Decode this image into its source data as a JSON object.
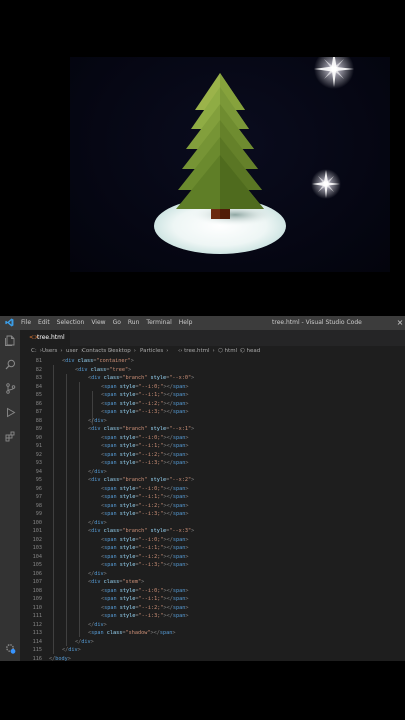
{
  "menu": [
    "File",
    "Edit",
    "Selection",
    "View",
    "Go",
    "Run",
    "Terminal",
    "Help"
  ],
  "window_title": "tree.html - Visual Studio Code",
  "tab": {
    "label": "tree.html",
    "icon": "html-file-icon"
  },
  "breadcrumb": [
    {
      "label": "C:"
    },
    {
      "label": "Users"
    },
    {
      "label": "user"
    },
    {
      "label": "Contacts"
    },
    {
      "label": "Desktop"
    },
    {
      "label": "Particles"
    },
    {
      "label": "tree.html",
      "icon": "html-file-icon"
    },
    {
      "label": "html",
      "icon": "element-icon"
    },
    {
      "label": "head",
      "icon": "element-icon"
    }
  ],
  "code_lines": [
    {
      "n": "81",
      "d": 0,
      "t": [
        [
          "p",
          "<"
        ],
        [
          "g",
          "div"
        ],
        [
          "t",
          " "
        ],
        [
          "a",
          "class"
        ],
        [
          "p",
          "="
        ],
        [
          "s",
          "\"container\""
        ],
        [
          "p",
          ">"
        ]
      ]
    },
    {
      "n": "82",
      "d": 1,
      "t": [
        [
          "p",
          "<"
        ],
        [
          "g",
          "div"
        ],
        [
          "t",
          " "
        ],
        [
          "a",
          "class"
        ],
        [
          "p",
          "="
        ],
        [
          "s",
          "\"tree\""
        ],
        [
          "p",
          ">"
        ]
      ]
    },
    {
      "n": "83",
      "d": 2,
      "t": [
        [
          "p",
          "<"
        ],
        [
          "g",
          "div"
        ],
        [
          "t",
          " "
        ],
        [
          "a",
          "class"
        ],
        [
          "p",
          "="
        ],
        [
          "s",
          "\"branch\""
        ],
        [
          "t",
          " "
        ],
        [
          "a",
          "style"
        ],
        [
          "p",
          "="
        ],
        [
          "s",
          "\"--x:0\""
        ],
        [
          "p",
          ">"
        ]
      ]
    },
    {
      "n": "84",
      "d": 3,
      "t": [
        [
          "p",
          "<"
        ],
        [
          "g",
          "span"
        ],
        [
          "t",
          " "
        ],
        [
          "a",
          "style"
        ],
        [
          "p",
          "="
        ],
        [
          "s",
          "\"--i:0;\""
        ],
        [
          "p",
          "></"
        ],
        [
          "g",
          "span"
        ],
        [
          "p",
          ">"
        ]
      ]
    },
    {
      "n": "85",
      "d": 3,
      "t": [
        [
          "p",
          "<"
        ],
        [
          "g",
          "span"
        ],
        [
          "t",
          " "
        ],
        [
          "a",
          "style"
        ],
        [
          "p",
          "="
        ],
        [
          "s",
          "\"--i:1;\""
        ],
        [
          "p",
          "></"
        ],
        [
          "g",
          "span"
        ],
        [
          "p",
          ">"
        ]
      ]
    },
    {
      "n": "86",
      "d": 3,
      "t": [
        [
          "p",
          "<"
        ],
        [
          "g",
          "span"
        ],
        [
          "t",
          " "
        ],
        [
          "a",
          "style"
        ],
        [
          "p",
          "="
        ],
        [
          "s",
          "\"--i:2;\""
        ],
        [
          "p",
          "></"
        ],
        [
          "g",
          "span"
        ],
        [
          "p",
          ">"
        ]
      ]
    },
    {
      "n": "87",
      "d": 3,
      "t": [
        [
          "p",
          "<"
        ],
        [
          "g",
          "span"
        ],
        [
          "t",
          " "
        ],
        [
          "a",
          "style"
        ],
        [
          "p",
          "="
        ],
        [
          "s",
          "\"--i:3;\""
        ],
        [
          "p",
          "></"
        ],
        [
          "g",
          "span"
        ],
        [
          "p",
          ">"
        ]
      ]
    },
    {
      "n": "88",
      "d": 2,
      "t": [
        [
          "p",
          "</"
        ],
        [
          "g",
          "div"
        ],
        [
          "p",
          ">"
        ]
      ]
    },
    {
      "n": "89",
      "d": 2,
      "t": [
        [
          "p",
          "<"
        ],
        [
          "g",
          "div"
        ],
        [
          "t",
          " "
        ],
        [
          "a",
          "class"
        ],
        [
          "p",
          "="
        ],
        [
          "s",
          "\"branch\""
        ],
        [
          "t",
          " "
        ],
        [
          "a",
          "style"
        ],
        [
          "p",
          "="
        ],
        [
          "s",
          "\"--x:1\""
        ],
        [
          "p",
          ">"
        ]
      ]
    },
    {
      "n": "90",
      "d": 3,
      "t": [
        [
          "p",
          "<"
        ],
        [
          "g",
          "span"
        ],
        [
          "t",
          " "
        ],
        [
          "a",
          "style"
        ],
        [
          "p",
          "="
        ],
        [
          "s",
          "\"--i:0;\""
        ],
        [
          "p",
          "></"
        ],
        [
          "g",
          "span"
        ],
        [
          "p",
          ">"
        ]
      ]
    },
    {
      "n": "91",
      "d": 3,
      "t": [
        [
          "p",
          "<"
        ],
        [
          "g",
          "span"
        ],
        [
          "t",
          " "
        ],
        [
          "a",
          "style"
        ],
        [
          "p",
          "="
        ],
        [
          "s",
          "\"--i:1;\""
        ],
        [
          "p",
          "></"
        ],
        [
          "g",
          "span"
        ],
        [
          "p",
          ">"
        ]
      ]
    },
    {
      "n": "92",
      "d": 3,
      "t": [
        [
          "p",
          "<"
        ],
        [
          "g",
          "span"
        ],
        [
          "t",
          " "
        ],
        [
          "a",
          "style"
        ],
        [
          "p",
          "="
        ],
        [
          "s",
          "\"--i:2;\""
        ],
        [
          "p",
          "></"
        ],
        [
          "g",
          "span"
        ],
        [
          "p",
          ">"
        ]
      ]
    },
    {
      "n": "93",
      "d": 3,
      "t": [
        [
          "p",
          "<"
        ],
        [
          "g",
          "span"
        ],
        [
          "t",
          " "
        ],
        [
          "a",
          "style"
        ],
        [
          "p",
          "="
        ],
        [
          "s",
          "\"--i:3;\""
        ],
        [
          "p",
          "></"
        ],
        [
          "g",
          "span"
        ],
        [
          "p",
          ">"
        ]
      ]
    },
    {
      "n": "94",
      "d": 2,
      "t": [
        [
          "p",
          "</"
        ],
        [
          "g",
          "div"
        ],
        [
          "p",
          ">"
        ]
      ]
    },
    {
      "n": "95",
      "d": 2,
      "t": [
        [
          "p",
          "<"
        ],
        [
          "g",
          "div"
        ],
        [
          "t",
          " "
        ],
        [
          "a",
          "class"
        ],
        [
          "p",
          "="
        ],
        [
          "s",
          "\"branch\""
        ],
        [
          "t",
          " "
        ],
        [
          "a",
          "style"
        ],
        [
          "p",
          "="
        ],
        [
          "s",
          "\"--x:2\""
        ],
        [
          "p",
          ">"
        ]
      ]
    },
    {
      "n": "96",
      "d": 3,
      "t": [
        [
          "p",
          "<"
        ],
        [
          "g",
          "span"
        ],
        [
          "t",
          " "
        ],
        [
          "a",
          "style"
        ],
        [
          "p",
          "="
        ],
        [
          "s",
          "\"--i:0;\""
        ],
        [
          "p",
          "></"
        ],
        [
          "g",
          "span"
        ],
        [
          "p",
          ">"
        ]
      ]
    },
    {
      "n": "97",
      "d": 3,
      "t": [
        [
          "p",
          "<"
        ],
        [
          "g",
          "span"
        ],
        [
          "t",
          " "
        ],
        [
          "a",
          "style"
        ],
        [
          "p",
          "="
        ],
        [
          "s",
          "\"--i:1;\""
        ],
        [
          "p",
          "></"
        ],
        [
          "g",
          "span"
        ],
        [
          "p",
          ">"
        ]
      ]
    },
    {
      "n": "98",
      "d": 3,
      "t": [
        [
          "p",
          "<"
        ],
        [
          "g",
          "span"
        ],
        [
          "t",
          " "
        ],
        [
          "a",
          "style"
        ],
        [
          "p",
          "="
        ],
        [
          "s",
          "\"--i:2;\""
        ],
        [
          "p",
          "></"
        ],
        [
          "g",
          "span"
        ],
        [
          "p",
          ">"
        ]
      ]
    },
    {
      "n": "99",
      "d": 3,
      "t": [
        [
          "p",
          "<"
        ],
        [
          "g",
          "span"
        ],
        [
          "t",
          " "
        ],
        [
          "a",
          "style"
        ],
        [
          "p",
          "="
        ],
        [
          "s",
          "\"--i:3;\""
        ],
        [
          "p",
          "></"
        ],
        [
          "g",
          "span"
        ],
        [
          "p",
          ">"
        ]
      ]
    },
    {
      "n": "100",
      "d": 2,
      "t": [
        [
          "p",
          "</"
        ],
        [
          "g",
          "div"
        ],
        [
          "p",
          ">"
        ]
      ]
    },
    {
      "n": "101",
      "d": 2,
      "t": [
        [
          "p",
          "<"
        ],
        [
          "g",
          "div"
        ],
        [
          "t",
          " "
        ],
        [
          "a",
          "class"
        ],
        [
          "p",
          "="
        ],
        [
          "s",
          "\"branch\""
        ],
        [
          "t",
          " "
        ],
        [
          "a",
          "style"
        ],
        [
          "p",
          "="
        ],
        [
          "s",
          "\"--x:3\""
        ],
        [
          "p",
          ">"
        ]
      ]
    },
    {
      "n": "102",
      "d": 3,
      "t": [
        [
          "p",
          "<"
        ],
        [
          "g",
          "span"
        ],
        [
          "t",
          " "
        ],
        [
          "a",
          "style"
        ],
        [
          "p",
          "="
        ],
        [
          "s",
          "\"--i:0;\""
        ],
        [
          "p",
          "></"
        ],
        [
          "g",
          "span"
        ],
        [
          "p",
          ">"
        ]
      ]
    },
    {
      "n": "103",
      "d": 3,
      "t": [
        [
          "p",
          "<"
        ],
        [
          "g",
          "span"
        ],
        [
          "t",
          " "
        ],
        [
          "a",
          "style"
        ],
        [
          "p",
          "="
        ],
        [
          "s",
          "\"--i:1;\""
        ],
        [
          "p",
          "></"
        ],
        [
          "g",
          "span"
        ],
        [
          "p",
          ">"
        ]
      ]
    },
    {
      "n": "104",
      "d": 3,
      "t": [
        [
          "p",
          "<"
        ],
        [
          "g",
          "span"
        ],
        [
          "t",
          " "
        ],
        [
          "a",
          "style"
        ],
        [
          "p",
          "="
        ],
        [
          "s",
          "\"--i:2;\""
        ],
        [
          "p",
          "></"
        ],
        [
          "g",
          "span"
        ],
        [
          "p",
          ">"
        ]
      ]
    },
    {
      "n": "105",
      "d": 3,
      "t": [
        [
          "p",
          "<"
        ],
        [
          "g",
          "span"
        ],
        [
          "t",
          " "
        ],
        [
          "a",
          "style"
        ],
        [
          "p",
          "="
        ],
        [
          "s",
          "\"--i:3;\""
        ],
        [
          "p",
          "></"
        ],
        [
          "g",
          "span"
        ],
        [
          "p",
          ">"
        ]
      ]
    },
    {
      "n": "106",
      "d": 2,
      "t": [
        [
          "p",
          "</"
        ],
        [
          "g",
          "div"
        ],
        [
          "p",
          ">"
        ]
      ]
    },
    {
      "n": "107",
      "d": 2,
      "t": [
        [
          "p",
          "<"
        ],
        [
          "g",
          "div"
        ],
        [
          "t",
          " "
        ],
        [
          "a",
          "class"
        ],
        [
          "p",
          "="
        ],
        [
          "s",
          "\"stem\""
        ],
        [
          "p",
          ">"
        ]
      ]
    },
    {
      "n": "108",
      "d": 3,
      "t": [
        [
          "p",
          "<"
        ],
        [
          "g",
          "span"
        ],
        [
          "t",
          " "
        ],
        [
          "a",
          "style"
        ],
        [
          "p",
          "="
        ],
        [
          "s",
          "\"--i:0;\""
        ],
        [
          "p",
          "></"
        ],
        [
          "g",
          "span"
        ],
        [
          "p",
          ">"
        ]
      ]
    },
    {
      "n": "109",
      "d": 3,
      "t": [
        [
          "p",
          "<"
        ],
        [
          "g",
          "span"
        ],
        [
          "t",
          " "
        ],
        [
          "a",
          "style"
        ],
        [
          "p",
          "="
        ],
        [
          "s",
          "\"--i:1;\""
        ],
        [
          "p",
          "></"
        ],
        [
          "g",
          "span"
        ],
        [
          "p",
          ">"
        ]
      ]
    },
    {
      "n": "110",
      "d": 3,
      "t": [
        [
          "p",
          "<"
        ],
        [
          "g",
          "span"
        ],
        [
          "t",
          " "
        ],
        [
          "a",
          "style"
        ],
        [
          "p",
          "="
        ],
        [
          "s",
          "\"--i:2;\""
        ],
        [
          "p",
          "></"
        ],
        [
          "g",
          "span"
        ],
        [
          "p",
          ">"
        ]
      ]
    },
    {
      "n": "111",
      "d": 3,
      "t": [
        [
          "p",
          "<"
        ],
        [
          "g",
          "span"
        ],
        [
          "t",
          " "
        ],
        [
          "a",
          "style"
        ],
        [
          "p",
          "="
        ],
        [
          "s",
          "\"--i:3;\""
        ],
        [
          "p",
          "></"
        ],
        [
          "g",
          "span"
        ],
        [
          "p",
          ">"
        ]
      ]
    },
    {
      "n": "112",
      "d": 2,
      "t": [
        [
          "p",
          "</"
        ],
        [
          "g",
          "div"
        ],
        [
          "p",
          ">"
        ]
      ]
    },
    {
      "n": "113",
      "d": 2,
      "t": [
        [
          "p",
          "<"
        ],
        [
          "g",
          "span"
        ],
        [
          "t",
          " "
        ],
        [
          "a",
          "class"
        ],
        [
          "p",
          "="
        ],
        [
          "s",
          "\"shadow\""
        ],
        [
          "p",
          "></"
        ],
        [
          "g",
          "span"
        ],
        [
          "p",
          ">"
        ]
      ]
    },
    {
      "n": "114",
      "d": 1,
      "t": [
        [
          "p",
          "</"
        ],
        [
          "g",
          "div"
        ],
        [
          "p",
          ">"
        ]
      ]
    },
    {
      "n": "115",
      "d": 0,
      "t": [
        [
          "p",
          "</"
        ],
        [
          "g",
          "div"
        ],
        [
          "p",
          ">"
        ]
      ]
    },
    {
      "n": "116",
      "d": -1,
      "t": [
        [
          "p",
          "</"
        ],
        [
          "g",
          "body"
        ],
        [
          "p",
          ">"
        ]
      ]
    }
  ],
  "colors": {
    "tag": "#569cd6",
    "attr": "#9cdcfe",
    "string": "#ce9178",
    "punct": "#808080",
    "bg": "#1e1e1e"
  }
}
